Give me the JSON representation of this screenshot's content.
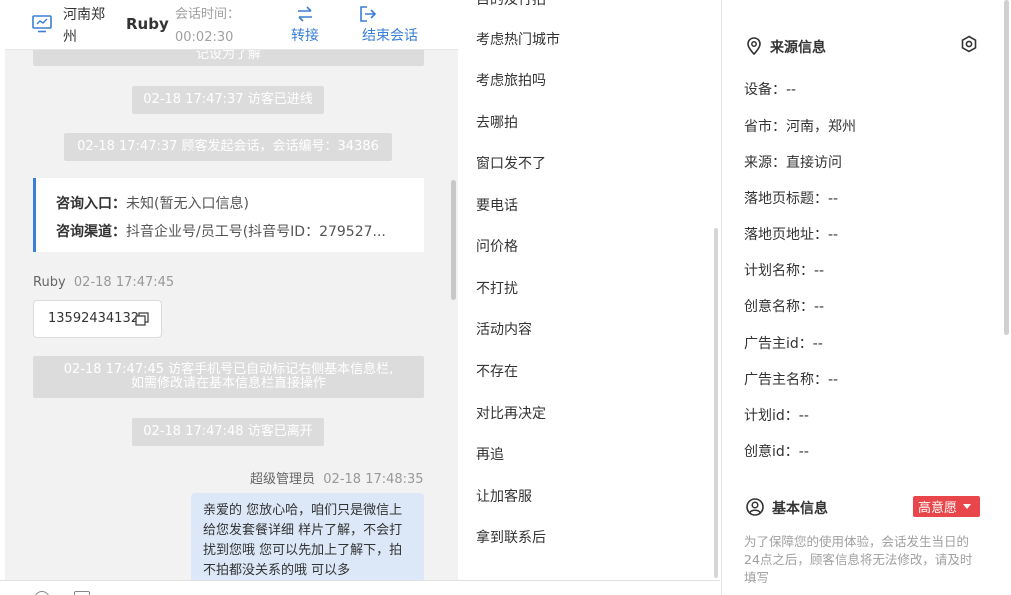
{
  "header": {
    "location": "河南郑州",
    "visitor_name": "Ruby",
    "time_label": "会话时间：",
    "time_value": "00:02:30",
    "transfer_label": "转接",
    "end_label": "结束会话"
  },
  "chat": {
    "partial_top": "记设为了解",
    "sys_entered": "02-18 17:47:37 访客已进线",
    "sys_started": "02-18 17:47:37 顾客发起会话，会话编号：34386",
    "entry_label": "咨询入口：",
    "entry_value": "未知(暂无入口信息)",
    "channel_label": "咨询渠道：",
    "channel_value": "抖音企业号/员工号(抖音号ID：279527...",
    "visitor_sender": "Ruby",
    "visitor_time": "02-18 17:47:45",
    "visitor_phone": "13592434132",
    "sys_phone_line1": "02-18 17:47:45 访客手机号已自动标记右侧基本信息栏,",
    "sys_phone_line2": "如需修改请在基本信息栏直接操作",
    "sys_left": "02-18 17:47:48 访客已离开",
    "agent_sender": "超级管理员",
    "agent_time": "02-18 17:48:35",
    "agent_message": "亲爱的 您放心哈，咱们只是微信上给您发套餐详细 样片了解，不会打扰到您哦 您可以先加上了解下，拍不拍都没关系的哦 可以多"
  },
  "quick_replies": [
    "目的及行拍",
    "考虑热门城市",
    "考虑旅拍吗",
    "去哪拍",
    "窗口发不了",
    "要电话",
    "问价格",
    "不打扰",
    "活动内容",
    "不存在",
    "对比再决定",
    "再追",
    "让加客服",
    "拿到联系后"
  ],
  "source_info": {
    "title": "来源信息",
    "rows": [
      {
        "label": "设备：",
        "value": "--"
      },
      {
        "label": "省市：",
        "value": "河南，郑州"
      },
      {
        "label": "来源：",
        "value": "直接访问"
      },
      {
        "label": "落地页标题：",
        "value": "--"
      },
      {
        "label": "落地页地址：",
        "value": "--"
      },
      {
        "label": "计划名称：",
        "value": "--"
      },
      {
        "label": "创意名称：",
        "value": "--"
      },
      {
        "label": "广告主id：",
        "value": "--"
      },
      {
        "label": "广告主名称：",
        "value": "--"
      },
      {
        "label": "计划id：",
        "value": "--"
      },
      {
        "label": "创意id：",
        "value": "--"
      }
    ]
  },
  "basic_info": {
    "title": "基本信息",
    "intent_badge": "高意愿",
    "note": "为了保障您的使用体验，会话发生当日的24点之后，顾客信息将无法修改，请及时填写"
  },
  "colors": {
    "accent": "#3a7fd6",
    "badge": "#e8464a",
    "agent_bubble": "#dce8f7",
    "system_msg": "#dcdcdc"
  }
}
